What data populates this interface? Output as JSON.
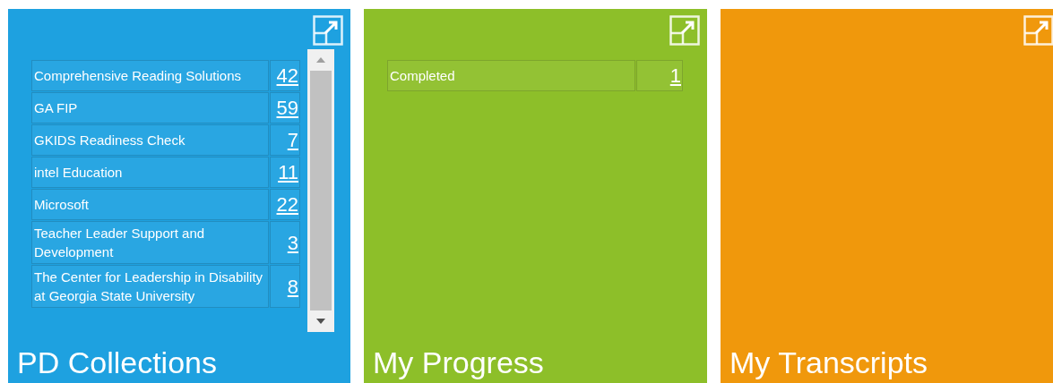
{
  "tiles": [
    {
      "title": "PD Collections",
      "color": "#1ea1e0",
      "scrollable": true,
      "rows": [
        {
          "label": "Comprehensive Reading Solutions",
          "count": "42"
        },
        {
          "label": "GA FIP",
          "count": "59"
        },
        {
          "label": "GKIDS Readiness Check",
          "count": "7"
        },
        {
          "label": "intel Education",
          "count": "11"
        },
        {
          "label": "Microsoft",
          "count": "22"
        },
        {
          "label": "Teacher Leader Support and Development",
          "count": "3"
        },
        {
          "label": "The Center for Leadership in Disability at Georgia State University",
          "count": "8"
        }
      ]
    },
    {
      "title": "My Progress",
      "color": "#8dbf29",
      "scrollable": false,
      "rows": [
        {
          "label": "Completed",
          "count": "1"
        }
      ]
    },
    {
      "title": "My Transcripts",
      "color": "#f0980c",
      "scrollable": false
    }
  ]
}
